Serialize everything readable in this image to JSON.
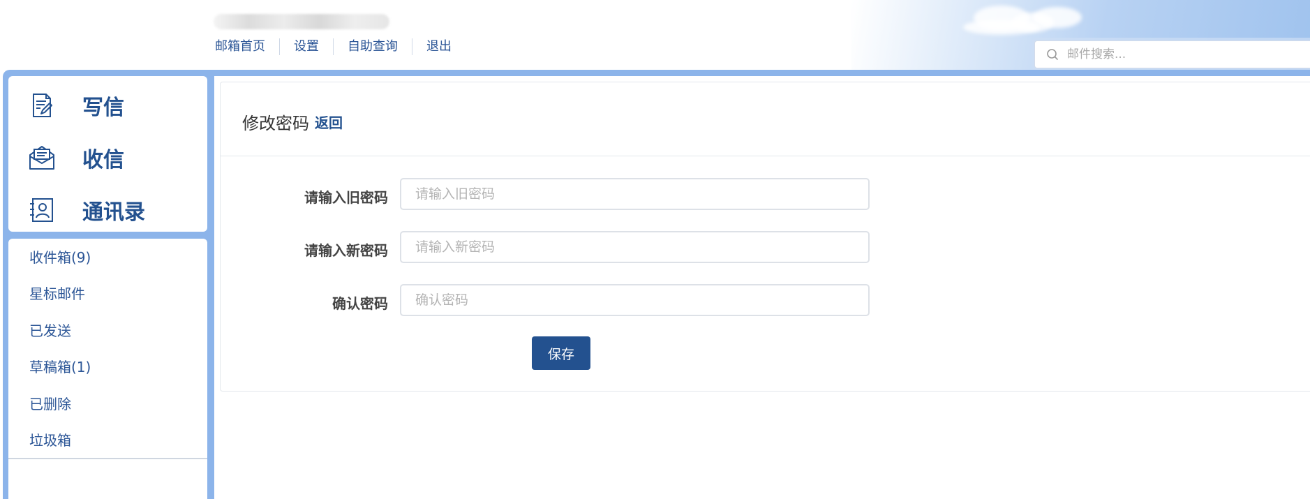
{
  "header": {
    "nav": [
      {
        "label": "邮箱首页"
      },
      {
        "label": "设置"
      },
      {
        "label": "自助查询"
      },
      {
        "label": "退出"
      }
    ],
    "search": {
      "placeholder": "邮件搜索..."
    }
  },
  "sidebar": {
    "actions": [
      {
        "label": "写信",
        "icon": "compose-icon"
      },
      {
        "label": "收信",
        "icon": "inbox-envelope-icon"
      },
      {
        "label": "通讯录",
        "icon": "contacts-icon"
      }
    ],
    "folders": [
      {
        "label": "收件箱(9)"
      },
      {
        "label": "星标邮件"
      },
      {
        "label": "已发送"
      },
      {
        "label": "草稿箱(1)"
      },
      {
        "label": "已删除"
      },
      {
        "label": "垃圾箱"
      }
    ]
  },
  "main": {
    "title": "修改密码",
    "back_label": "返回",
    "form": {
      "old_password": {
        "label": "请输入旧密码",
        "placeholder": "请输入旧密码",
        "value": ""
      },
      "new_password": {
        "label": "请输入新密码",
        "placeholder": "请输入新密码",
        "value": ""
      },
      "confirm_password": {
        "label": "确认密码",
        "placeholder": "确认密码",
        "value": ""
      },
      "save_label": "保存"
    }
  },
  "colors": {
    "brand": "#23518f",
    "link": "#2b5596",
    "frame": "#8cb4ea"
  }
}
